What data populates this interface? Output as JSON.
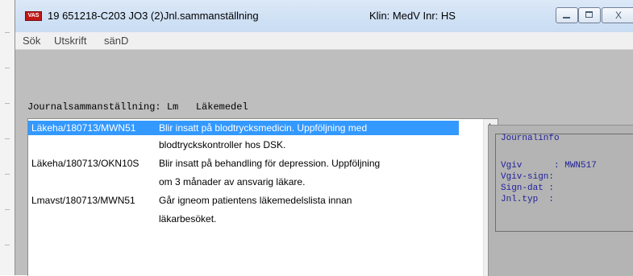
{
  "titlebar": {
    "icon": "VAS",
    "title": "19 651218-C203  JO3 (2)Jnl.sammanställning",
    "context": "Klin: MedV  Inr: HS",
    "close_glyph": "X"
  },
  "menu": [
    "Sök",
    "Utskrift",
    "sänD"
  ],
  "section": {
    "label": "Journalsammanställning: Lm   Läkemedel"
  },
  "journal_rows": [
    {
      "source": "Läkeha/180713/MWN51",
      "text": "Blir insatt på blodtrycksmedicin. Uppföljning med",
      "selected": true
    },
    {
      "source": "",
      "text": "blodtryckskontroller hos DSK.",
      "selected": false
    },
    {
      "source": "Läkeha/180713/OKN10S",
      "text": "Blir insatt på behandling för depression. Uppföljning",
      "selected": false
    },
    {
      "source": "",
      "text": "om 3 månader av ansvarig läkare.",
      "selected": false
    },
    {
      "source": "Lmavst/180713/MWN51",
      "text": "Går igneom patientens läkemedelslista innan",
      "selected": false
    },
    {
      "source": "",
      "text": "läkarbesöket.",
      "selected": false
    }
  ],
  "journalinfo": {
    "title": "Journalinfo",
    "fields": [
      {
        "label": "Vgiv      : MWN517"
      },
      {
        "label": "Vgiv-sign:"
      },
      {
        "label": "Sign-dat :"
      },
      {
        "label": "Jnl.typ  :"
      }
    ]
  },
  "colors": {
    "selection": "#3399ff",
    "window_bg": "#bebebe",
    "info_text": "#1f1f9a"
  }
}
